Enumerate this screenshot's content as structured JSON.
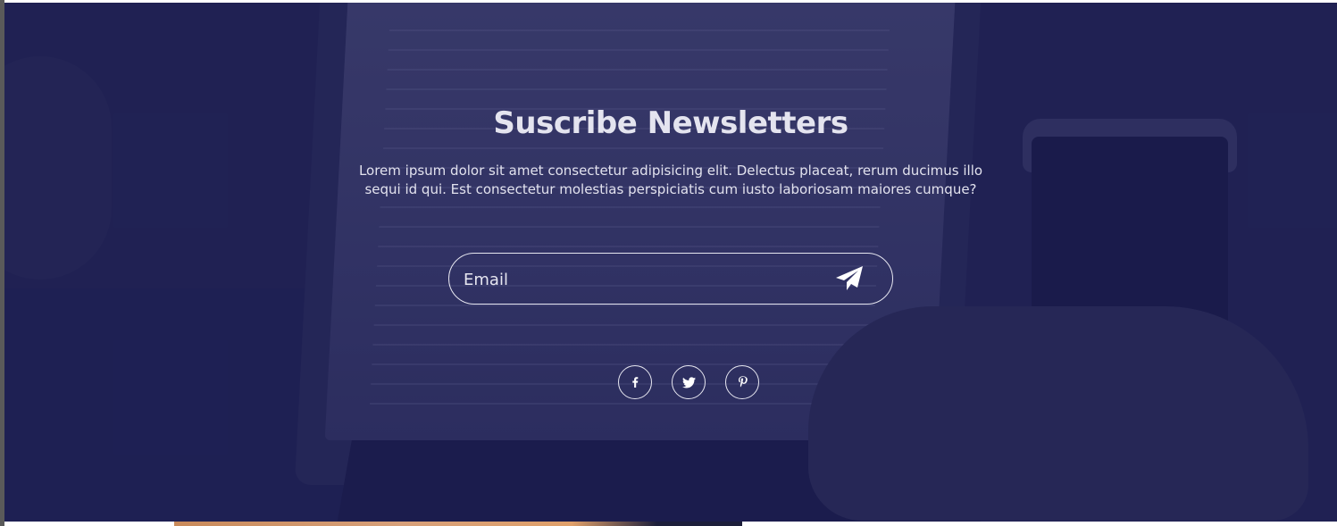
{
  "newsletter": {
    "title": "Suscribe Newsletters",
    "description": "Lorem ipsum dolor sit amet consectetur adipisicing elit. Delectus placeat, rerum ducimus illo sequi id qui. Est consectetur molestias perspiciatis cum iusto laboriosam maiores cumque?",
    "email_placeholder": "Email",
    "send_icon": "paper-plane-icon"
  },
  "social": [
    {
      "name": "facebook",
      "icon": "facebook-icon"
    },
    {
      "name": "twitter",
      "icon": "twitter-icon"
    },
    {
      "name": "pinterest",
      "icon": "pinterest-icon"
    }
  ],
  "colors": {
    "overlay": "#25275a",
    "text": "#e4e4ef",
    "border": "#e6e6f0"
  }
}
